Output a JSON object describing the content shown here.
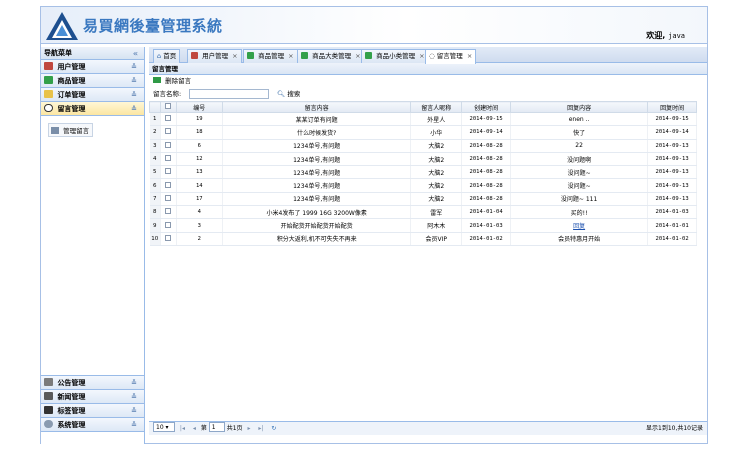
{
  "header": {
    "system_title": "易買網後臺管理系統",
    "welcome_label": "欢迎,",
    "username": "java"
  },
  "sidebar": {
    "nav_title": "导航菜单",
    "top_items": [
      {
        "label": "用户管理",
        "icon": "users-icon"
      },
      {
        "label": "商品管理",
        "icon": "goods-icon"
      },
      {
        "label": "订单管理",
        "icon": "order-icon"
      },
      {
        "label": "留言管理",
        "icon": "message-icon"
      }
    ],
    "sub_item": "管理留言",
    "bottom_items": [
      {
        "label": "公告管理",
        "icon": "notice-icon"
      },
      {
        "label": "新闻管理",
        "icon": "news-icon"
      },
      {
        "label": "标签管理",
        "icon": "tag-icon"
      },
      {
        "label": "系统管理",
        "icon": "system-icon"
      }
    ]
  },
  "tabs": [
    {
      "label": "首页",
      "closable": false
    },
    {
      "label": "用户管理",
      "closable": true
    },
    {
      "label": "商品管理",
      "closable": true
    },
    {
      "label": "商品大类管理",
      "closable": true
    },
    {
      "label": "商品小类管理",
      "closable": true
    },
    {
      "label": "留言管理",
      "closable": true
    }
  ],
  "panel": {
    "title": "留言管理",
    "delete_label": "删除留言",
    "search_label": "留言名称:",
    "search_value": "",
    "search_button": "搜索"
  },
  "table": {
    "headers": [
      "编号",
      "留言内容",
      "留言人昵称",
      "创建时间",
      "回复内容",
      "回复时间"
    ],
    "rows": [
      {
        "n": "1",
        "id": "19",
        "content": "某某订单有问题",
        "nick": "外星人",
        "created": "2014-09-15",
        "reply": "enen ..",
        "replied": "2014-09-15"
      },
      {
        "n": "2",
        "id": "18",
        "content": "什么时候发货?",
        "nick": "小华",
        "created": "2014-09-14",
        "reply": "快了",
        "replied": "2014-09-14"
      },
      {
        "n": "3",
        "id": "6",
        "content": "1234单号,有问题",
        "nick": "大脑2",
        "created": "2014-08-28",
        "reply": "22",
        "replied": "2014-09-13"
      },
      {
        "n": "4",
        "id": "12",
        "content": "1234单号,有问题",
        "nick": "大脑2",
        "created": "2014-08-28",
        "reply": "没问题啊",
        "replied": "2014-09-13"
      },
      {
        "n": "5",
        "id": "13",
        "content": "1234单号,有问题",
        "nick": "大脑2",
        "created": "2014-08-28",
        "reply": "没问题~",
        "replied": "2014-09-13"
      },
      {
        "n": "6",
        "id": "14",
        "content": "1234单号,有问题",
        "nick": "大脑2",
        "created": "2014-08-28",
        "reply": "没问题~",
        "replied": "2014-09-13"
      },
      {
        "n": "7",
        "id": "17",
        "content": "1234单号,有问题",
        "nick": "大脑2",
        "created": "2014-08-28",
        "reply": "没问题~ 111",
        "replied": "2014-09-13"
      },
      {
        "n": "8",
        "id": "4",
        "content": "小米4发布了 1999 16G 3200W像素",
        "nick": "雷军",
        "created": "2014-01-04",
        "reply": "买的!!",
        "replied": "2014-01-03"
      },
      {
        "n": "9",
        "id": "3",
        "content": "开始配货开始配货开始配货",
        "nick": "阿木木",
        "created": "2014-01-03",
        "reply": "回复",
        "replied": "2014-01-01"
      },
      {
        "n": "10",
        "id": "2",
        "content": "积分大返利,机不可失失不再来",
        "nick": "会员VIP",
        "created": "2014-01-02",
        "reply": "会员特惠月开始",
        "replied": "2014-01-02"
      }
    ]
  },
  "pager": {
    "page_size": "10",
    "page_prefix": "第",
    "current_page": "1",
    "page_suffix": "共1页",
    "info": "显示1到10,共10记录"
  },
  "colors": {
    "accent": "#99bbe8",
    "logo_text": "#3a78c0",
    "active_menu": "#fbe6a2"
  }
}
